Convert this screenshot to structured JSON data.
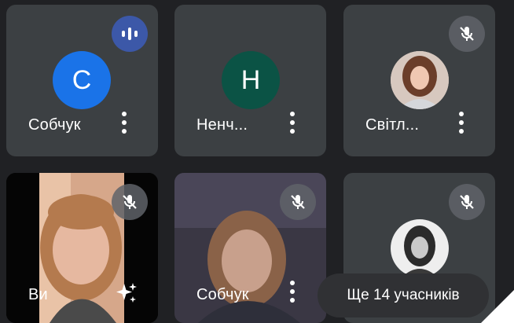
{
  "participants": [
    {
      "name": "Собчук",
      "initial": "С",
      "avatar_color": "#1a73e8",
      "status": "speaking"
    },
    {
      "name": "Ненч...",
      "initial": "Н",
      "avatar_color": "#0b5345",
      "status": "normal"
    },
    {
      "name": "Світл...",
      "status": "muted"
    },
    {
      "name": "Ви",
      "status": "muted",
      "is_self": true
    },
    {
      "name": "Собчук",
      "status": "muted"
    },
    {
      "name": "",
      "status": "muted"
    }
  ],
  "more_participants_label": "Ще 14 учасників",
  "icons": {
    "speaking": "audio-wave-icon",
    "muted": "mic-off-icon",
    "menu": "more-vert-icon",
    "effects": "sparkle-icon"
  }
}
